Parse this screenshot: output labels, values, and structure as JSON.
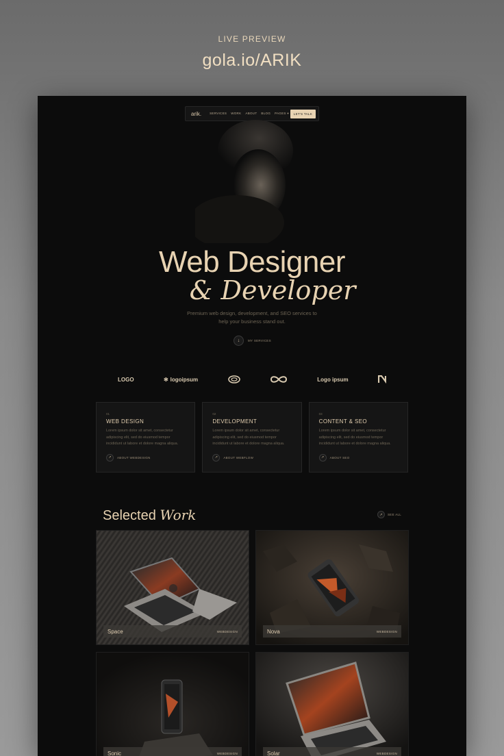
{
  "preview": {
    "label": "LIVE PREVIEW",
    "url": "gola.io/ARIK"
  },
  "nav": {
    "logo": "arik.",
    "links": [
      "SERVICES",
      "WORK",
      "ABOUT",
      "BLOG",
      "PAGES ▾"
    ],
    "cta": "LET'S TALK"
  },
  "hero": {
    "title_line1": "Web Designer",
    "title_line2": "& Developer",
    "subtitle": "Premium web design, development, and SEO services to help your business stand out.",
    "button_label": "MY SERVICES"
  },
  "logos": [
    "LOGO",
    "logoipsum",
    "",
    "",
    "Logo ipsum",
    ""
  ],
  "services": [
    {
      "num": "01",
      "title": "WEB DESIGN",
      "text": "Lorem ipsum dolor sit amet, consectetur adipiscing elit, sed do eiusmod tempor incididunt ut labore et dolore magna aliqua.",
      "link": "ABOUT WEBDESIGN"
    },
    {
      "num": "02",
      "title": "DEVELOPMENT",
      "text": "Lorem ipsum dolor sit amet, consectetur adipiscing elit, sed do eiusmod tempor incididunt ut labore et dolore magna aliqua.",
      "link": "ABOUT WEBFLOW"
    },
    {
      "num": "03",
      "title": "CONTENT & SEO",
      "text": "Lorem ipsum dolor sit amet, consectetur adipiscing elit, sed do eiusmod tempor incididunt ut labore et dolore magna aliqua.",
      "link": "ABOUT SEO"
    }
  ],
  "work": {
    "heading_plain": "Selected ",
    "heading_italic": "Work",
    "see_all": "SEE ALL",
    "projects": [
      {
        "name": "Space",
        "tag": "WEBDESIGN"
      },
      {
        "name": "Nova",
        "tag": "WEBDESIGN"
      },
      {
        "name": "Sonic",
        "tag": "WEBDESIGN"
      },
      {
        "name": "Solar",
        "tag": "WEBDESIGN"
      }
    ]
  },
  "colors": {
    "accent": "#e8d3b2",
    "background": "#0c0c0c",
    "card": "#151515"
  }
}
